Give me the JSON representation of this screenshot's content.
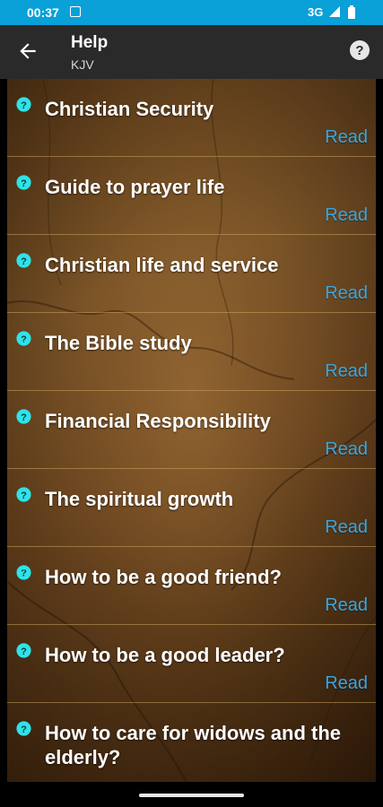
{
  "status_bar": {
    "time": "00:37",
    "network": "3G"
  },
  "app_bar": {
    "title": "Help",
    "subtitle": "KJV"
  },
  "items": [
    {
      "title": "Christian Security",
      "action": "Read"
    },
    {
      "title": "Guide to prayer life",
      "action": "Read"
    },
    {
      "title": "Christian life and service",
      "action": "Read"
    },
    {
      "title": "The Bible study",
      "action": "Read"
    },
    {
      "title": "Financial Responsibility",
      "action": "Read"
    },
    {
      "title": "The spiritual growth",
      "action": "Read"
    },
    {
      "title": "How to be a good friend?",
      "action": "Read"
    },
    {
      "title": "How to be a good leader?",
      "action": "Read"
    },
    {
      "title": "How to care for widows and the elderly?",
      "action": ""
    }
  ],
  "colors": {
    "status_bar": "#0aa0d8",
    "app_bar": "#2a2a2a",
    "read_link": "#3aa6e0",
    "question_icon": "#2fe3e8"
  },
  "icons": {
    "back": "arrow-left-icon",
    "help": "help-circle-icon",
    "item": "question-circle-icon"
  }
}
